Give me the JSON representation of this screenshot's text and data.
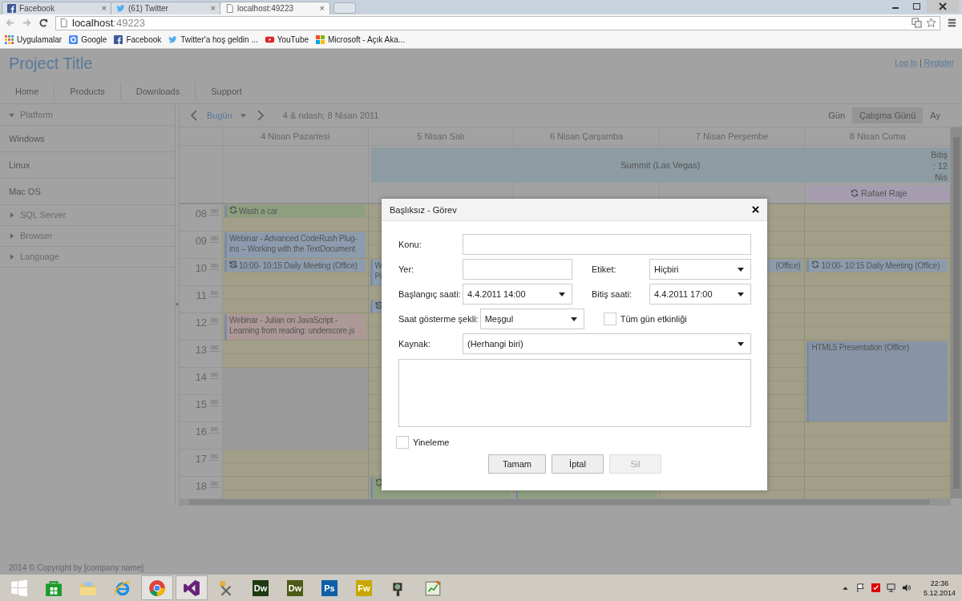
{
  "browser": {
    "tabs": [
      {
        "title": "Facebook",
        "kind": "facebook",
        "close": "×",
        "selected": false
      },
      {
        "title": "(61) Twitter",
        "kind": "twitter",
        "close": "×",
        "selected": false
      },
      {
        "title": "localhost:49223",
        "kind": "page",
        "close": "×",
        "selected": true
      }
    ],
    "url_host": "localhost",
    "url_port": ":49223",
    "bookmarks": [
      {
        "label": "Uygulamalar",
        "kind": "apps"
      },
      {
        "label": "Google",
        "kind": "google"
      },
      {
        "label": "Facebook",
        "kind": "facebook"
      },
      {
        "label": "Twitter'a hoş geldin ...",
        "kind": "twitter"
      },
      {
        "label": "YouTube",
        "kind": "youtube"
      },
      {
        "label": "Microsoft - Açık Aka...",
        "kind": "microsoft"
      }
    ]
  },
  "site": {
    "title": "Project Title",
    "login": "Log In",
    "separator": "|",
    "register": "Register",
    "nav": [
      "Home",
      "Products",
      "Downloads",
      "Support"
    ],
    "footer": "2014 © Copyright by [company name]"
  },
  "sidebar": [
    {
      "label": "Platform",
      "expanded": true,
      "children": [
        {
          "label": "Windows"
        },
        {
          "label": "Linux"
        },
        {
          "label": "Mac OS"
        }
      ]
    },
    {
      "label": "SQL Server",
      "expanded": false
    },
    {
      "label": "Browser",
      "expanded": false
    },
    {
      "label": "Language",
      "expanded": false
    }
  ],
  "scheduler": {
    "today": "Bugün",
    "range": "4 & ndash; 8 Nisan 2011",
    "views": [
      {
        "label": "Gün",
        "selected": false
      },
      {
        "label": "Çalışma Günü",
        "selected": true
      },
      {
        "label": "Ay",
        "selected": false
      }
    ],
    "days": [
      {
        "label": "4 Nisan Pazartesi",
        "events": [
          {
            "title": "Wash a car",
            "color": "#8e9f80",
            "kind": "recurring"
          },
          {
            "title": "Webinar - Advanced CodeRush Plug-ins – Working with the TextDocument",
            "color": "#8c9cae",
            "kind": "single"
          },
          {
            "title": "10:00- 10:15 Daily Meeting (Office)",
            "color": "#8c9cae",
            "kind": "exception"
          },
          {
            "title": "Webinar - Julian on JavaScript - Learning from reading: underscore.js",
            "color": "#ad9898",
            "kind": "single"
          }
        ]
      },
      {
        "label": "5 Nisan Salı",
        "events": [
          {
            "title": "W\nPi",
            "color": "#8c9cae",
            "kind": "single"
          },
          {
            "color": "#8c9cae",
            "kind": "exception"
          },
          {
            "color": "#8e9f80",
            "kind": "recurring"
          }
        ]
      },
      {
        "label": "6 Nisan Çarşamba",
        "events": [
          {
            "color": "#8e9f80",
            "kind": "single"
          }
        ]
      },
      {
        "label": "7 Nisan Perşembe",
        "events": [
          {
            "title": "(Office)",
            "color": "#8c9cae",
            "kind": "single"
          }
        ]
      },
      {
        "label": "8 Nisan Cuma",
        "events": [
          {
            "title": "10:00- 10:15 Daily Meeting (Office)",
            "color": "#8c9cae",
            "kind": "recurring"
          },
          {
            "title": "HTML5 Presentation (Office)",
            "color": "#8694a6",
            "kind": "single"
          }
        ]
      }
    ],
    "all_day": [
      {
        "title": "Summit (Las Vegas)",
        "continues": "Bitiş : 12 Nis",
        "color": "#8c9ca2",
        "kind": "single"
      },
      {
        "title": "Rafael Raje",
        "color": "#a69cb0",
        "kind": "recurring"
      }
    ],
    "hours": [
      {
        "hour": "08",
        "minute": "00"
      },
      {
        "hour": "09",
        "minute": "00"
      },
      {
        "hour": "10",
        "minute": "00"
      },
      {
        "hour": "11",
        "minute": "00"
      },
      {
        "hour": "12",
        "minute": "00"
      },
      {
        "hour": "13",
        "minute": "00"
      },
      {
        "hour": "14",
        "minute": "00"
      },
      {
        "hour": "15",
        "minute": "00"
      },
      {
        "hour": "16",
        "minute": "00"
      },
      {
        "hour": "17",
        "minute": "00"
      },
      {
        "hour": "18",
        "minute": "00"
      }
    ]
  },
  "dialog": {
    "title": "Başlıksız - Görev",
    "subject_label": "Konu:",
    "location_label": "Yer:",
    "label_label": "Etiket:",
    "label_value": "Hiçbiri",
    "start_label": "Başlangıç saati:",
    "start_value": "4.4.2011 14:00",
    "end_label": "Bitiş saati:",
    "end_value": "4.4.2011 17:00",
    "show_as_label": "Saat gösterme şekli:",
    "show_as_value": "Meşgul",
    "all_day_label": "Tüm gün etkinliği",
    "all_day": false,
    "resource_label": "Kaynak:",
    "resource_value": "(Herhangi biri)",
    "recurrence_label": "Yineleme",
    "recurrence": false,
    "buttons": [
      {
        "label": "Tamam",
        "disabled": false
      },
      {
        "label": "İptal",
        "disabled": false
      },
      {
        "label": "Sil",
        "disabled": true
      }
    ]
  },
  "taskbar": {
    "apps": [
      {
        "kind": "start",
        "active": false
      },
      {
        "kind": "store",
        "active": false
      },
      {
        "kind": "folder",
        "active": false
      },
      {
        "kind": "ie",
        "active": false
      },
      {
        "kind": "chrome",
        "active": true
      },
      {
        "kind": "vs",
        "active": true
      },
      {
        "kind": "tool",
        "active": false
      },
      {
        "kind": "letters",
        "label": "Dw",
        "color": "#1e3a12",
        "active": false
      },
      {
        "kind": "letters",
        "label": "Dw",
        "color": "#4c5a16",
        "active": false
      },
      {
        "kind": "letters",
        "label": "Ps",
        "color": "#0e5fa8",
        "active": false
      },
      {
        "kind": "letters",
        "label": "Fw",
        "color": "#c8a800",
        "active": false
      },
      {
        "kind": "camera",
        "active": false
      },
      {
        "kind": "chart",
        "active": false
      }
    ],
    "time": "22:36",
    "date": "5.12.2014"
  }
}
